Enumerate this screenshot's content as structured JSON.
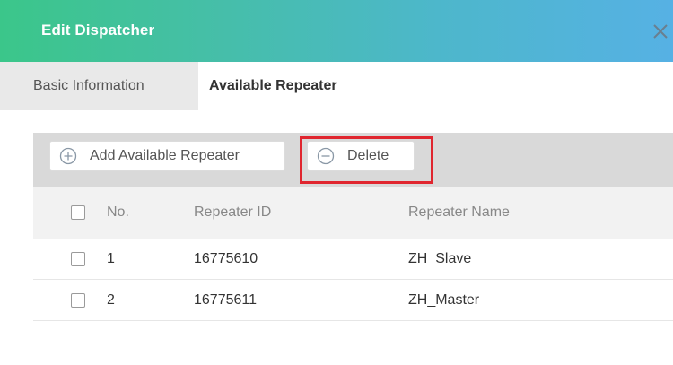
{
  "dialog": {
    "title": "Edit Dispatcher",
    "close_icon": "close-icon"
  },
  "tabs": [
    {
      "label": "Basic Information",
      "active": false
    },
    {
      "label": "Available Repeater",
      "active": true
    }
  ],
  "toolbar": {
    "add_label": "Add Available Repeater",
    "add_icon": "plus-circle-icon",
    "delete_label": "Delete",
    "delete_icon": "minus-circle-icon",
    "highlight_color": "#e0262f"
  },
  "table": {
    "headers": {
      "no": "No.",
      "repeater_id": "Repeater ID",
      "repeater_name": "Repeater Name"
    },
    "rows": [
      {
        "no": "1",
        "repeater_id": "16775610",
        "repeater_name": "ZH_Slave"
      },
      {
        "no": "2",
        "repeater_id": "16775611",
        "repeater_name": "ZH_Master"
      }
    ]
  },
  "colors": {
    "header_gradient_start": "#3bc68a",
    "header_gradient_end": "#56b1e4",
    "toolbar_bg": "#d9d9d9"
  }
}
